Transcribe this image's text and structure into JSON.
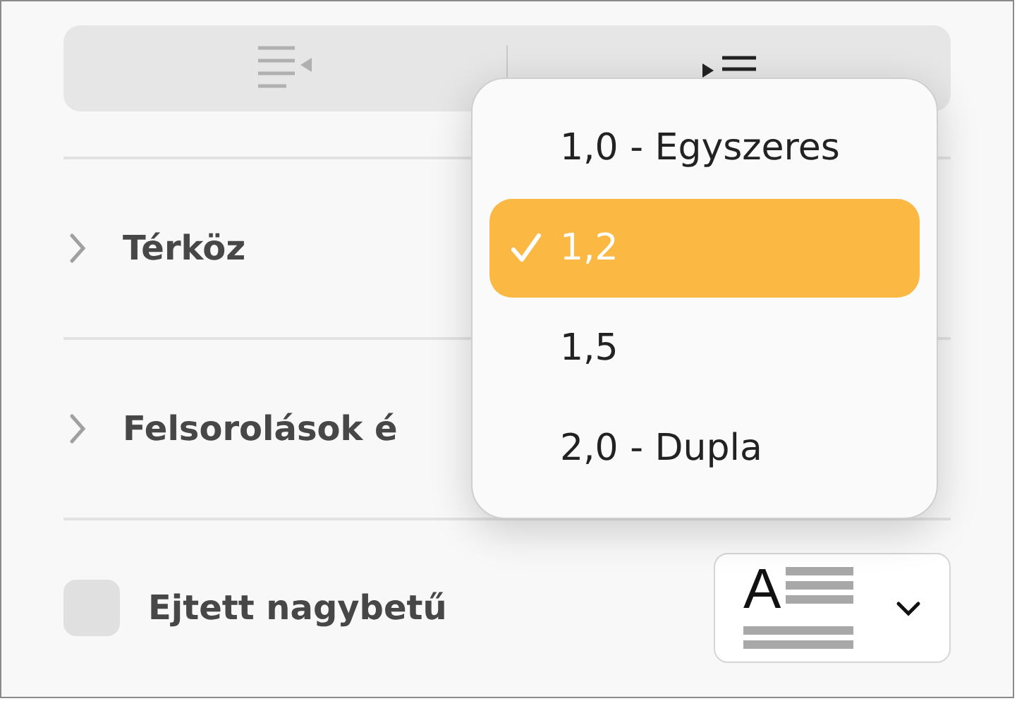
{
  "indent_buttons": [
    {
      "kind": "outdent",
      "disabled": true
    },
    {
      "kind": "indent",
      "disabled": false
    }
  ],
  "rows": [
    {
      "kind": "disclosure",
      "label": "Térköz",
      "expanded": false
    },
    {
      "kind": "disclosure",
      "label": "Felsorolások é",
      "expanded": false
    },
    {
      "kind": "checkbox",
      "label": "Ejtett nagybetű",
      "checked": false
    }
  ],
  "dropcap_button": {
    "glyph": "A"
  },
  "menu": {
    "items": [
      {
        "label": "1,0 - Egyszeres",
        "selected": false
      },
      {
        "label": "1,2",
        "selected": true
      },
      {
        "label": "1,5",
        "selected": false
      },
      {
        "label": "2,0 - Dupla",
        "selected": false
      }
    ]
  }
}
